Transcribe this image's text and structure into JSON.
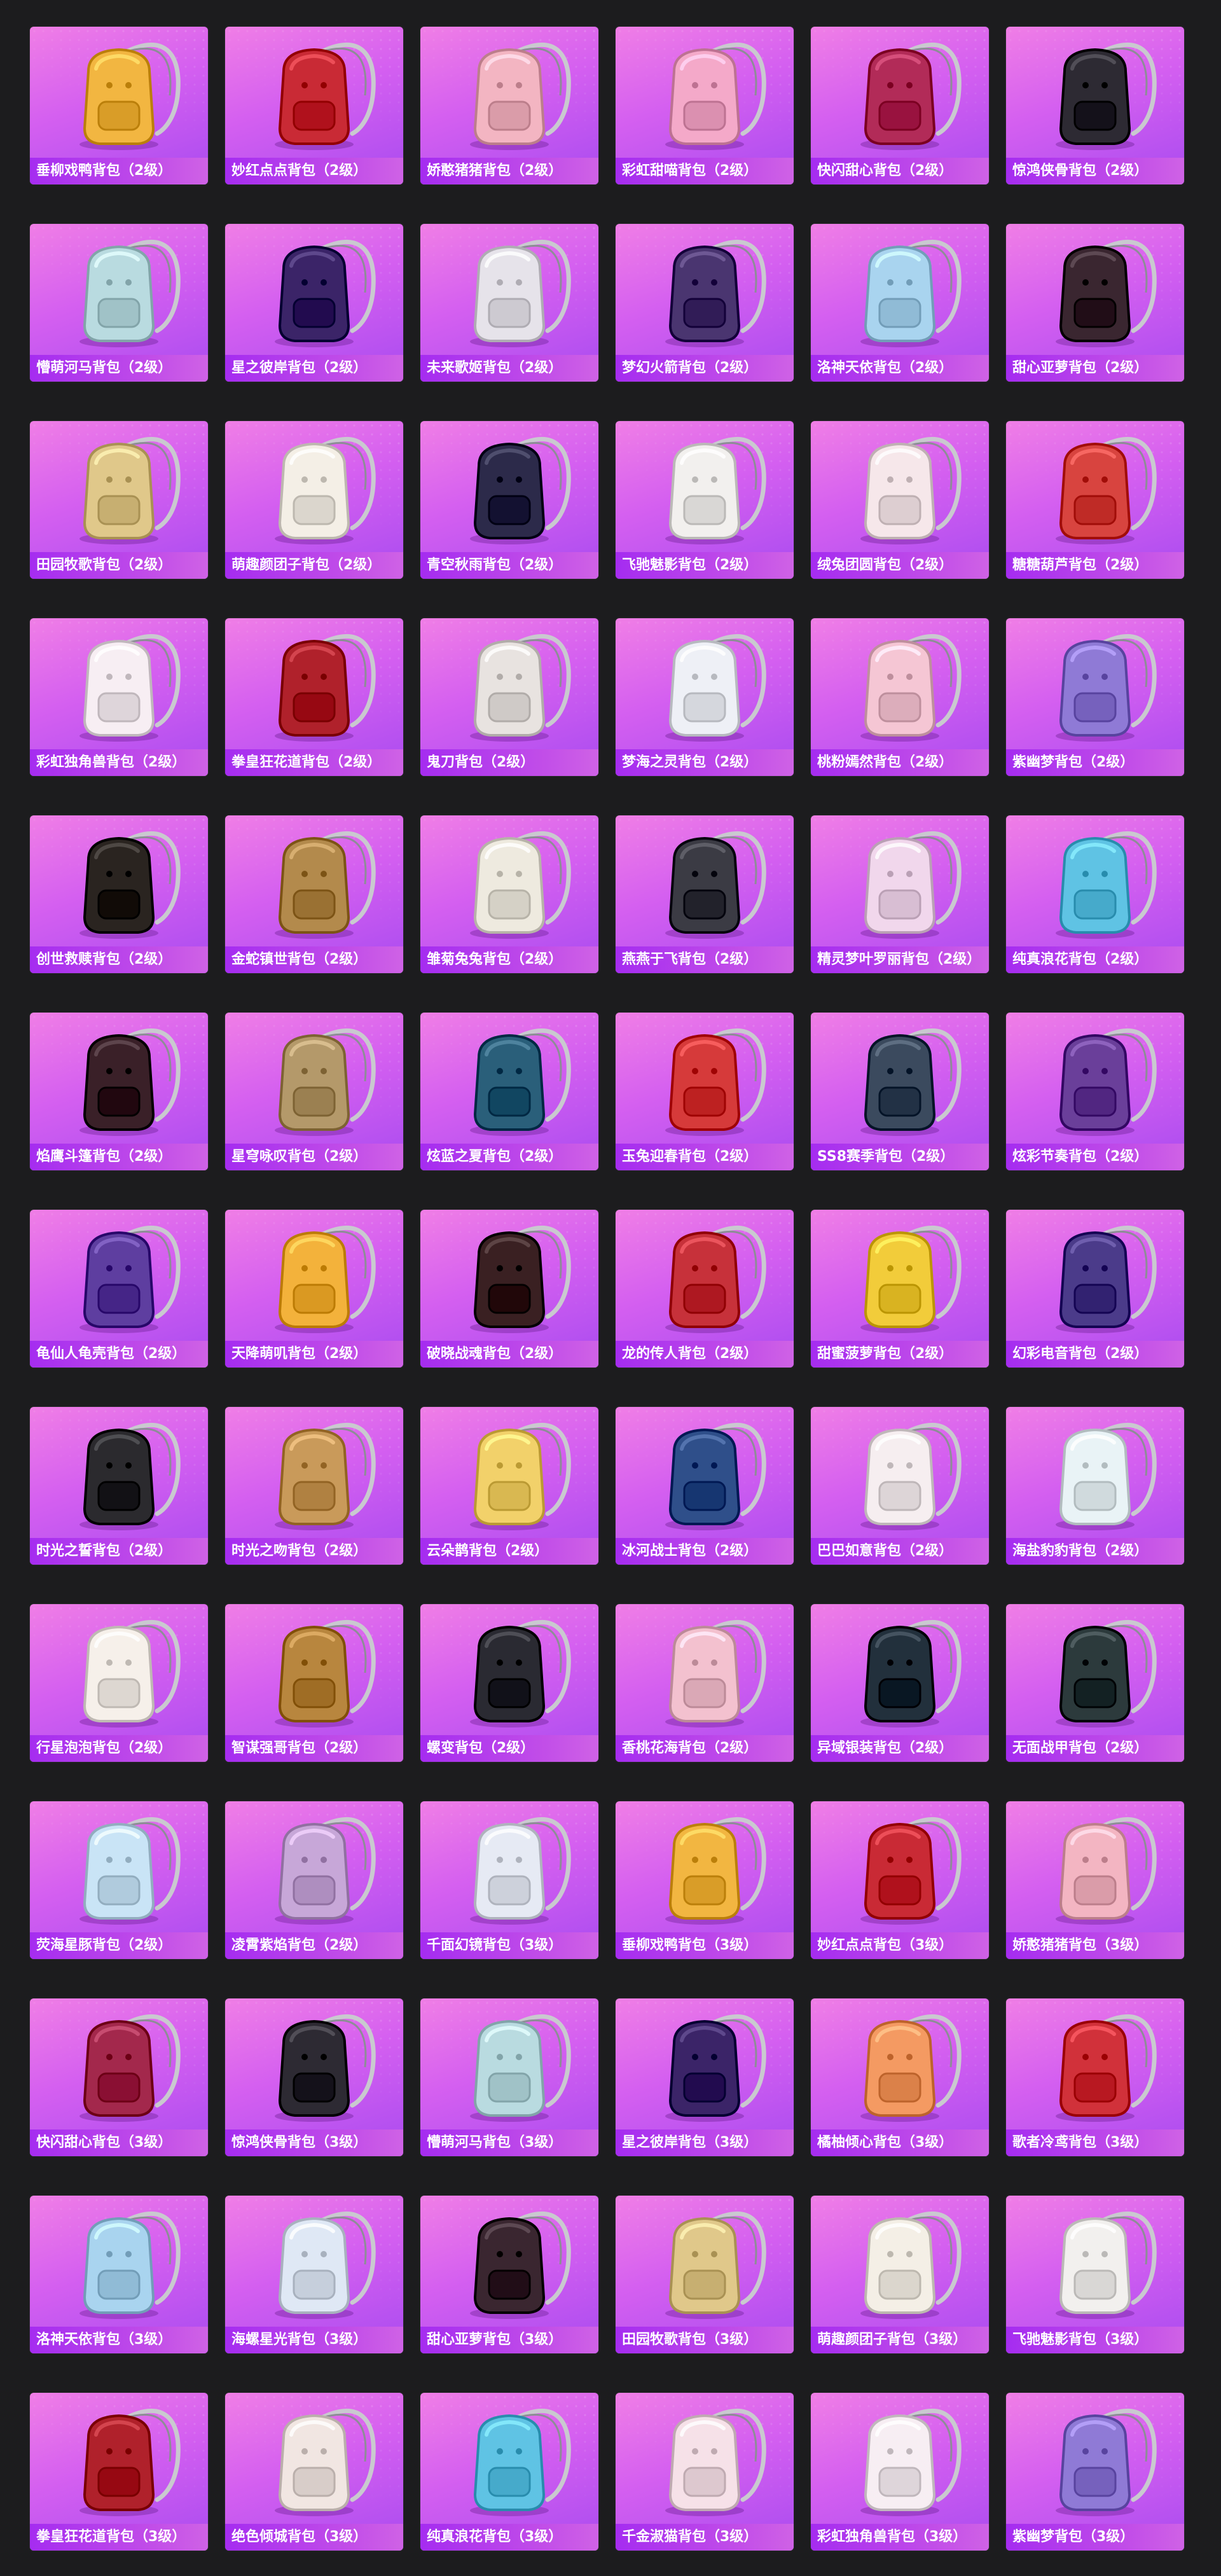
{
  "items": [
    {
      "name": "垂柳戏鸭背包（2级）",
      "color": "#f2b641",
      "icon": "backpack-icon"
    },
    {
      "name": "妙红点点背包（2级）",
      "color": "#c92a35",
      "icon": "backpack-icon"
    },
    {
      "name": "娇憨猪猪背包（2级）",
      "color": "#f3b5c2",
      "icon": "backpack-icon"
    },
    {
      "name": "彩虹甜喵背包（2级）",
      "color": "#f4a9c9",
      "icon": "backpack-icon"
    },
    {
      "name": "快闪甜心背包（2级）",
      "color": "#b22b58",
      "icon": "backpack-icon"
    },
    {
      "name": "惊鸿侠骨背包（2级）",
      "color": "#2d2a33",
      "icon": "backpack-icon"
    },
    {
      "name": "懵萌河马背包（2级）",
      "color": "#b9dbe0",
      "icon": "backpack-icon"
    },
    {
      "name": "星之彼岸背包（2级）",
      "color": "#3b2468",
      "icon": "backpack-icon"
    },
    {
      "name": "未来歌姬背包（2级）",
      "color": "#e6e3ea",
      "icon": "backpack-icon"
    },
    {
      "name": "梦幻火箭背包（2级）",
      "color": "#4a3570",
      "icon": "backpack-icon"
    },
    {
      "name": "洛神天依背包（2级）",
      "color": "#a9d4ef",
      "icon": "backpack-icon"
    },
    {
      "name": "甜心亚萝背包（2级）",
      "color": "#3a2630",
      "icon": "backpack-icon"
    },
    {
      "name": "田园牧歌背包（2级）",
      "color": "#e0c88a",
      "icon": "backpack-icon"
    },
    {
      "name": "萌趣颜团子背包（2级）",
      "color": "#f4efe6",
      "icon": "backpack-icon"
    },
    {
      "name": "青空秋雨背包（2级）",
      "color": "#2c2a4a",
      "icon": "backpack-icon"
    },
    {
      "name": "飞驰魅影背包（2级）",
      "color": "#f2f0ee",
      "icon": "backpack-icon"
    },
    {
      "name": "绒兔团圆背包（2级）",
      "color": "#f6e7ea",
      "icon": "backpack-icon"
    },
    {
      "name": "糖糖葫芦背包（2级）",
      "color": "#d8443f",
      "icon": "backpack-icon"
    },
    {
      "name": "彩虹独角兽背包（2级）",
      "color": "#f7eef3",
      "icon": "backpack-icon"
    },
    {
      "name": "拳皇狂花道背包（2级）",
      "color": "#b0212b",
      "icon": "backpack-icon"
    },
    {
      "name": "鬼刀背包（2级）",
      "color": "#e8e3e0",
      "icon": "backpack-icon"
    },
    {
      "name": "梦海之灵背包（2级）",
      "color": "#eef0f6",
      "icon": "backpack-icon"
    },
    {
      "name": "桃粉嫣然背包（2级）",
      "color": "#f5c6d4",
      "icon": "backpack-icon"
    },
    {
      "name": "紫幽梦背包（2级）",
      "color": "#8f7ad6",
      "icon": "backpack-icon"
    },
    {
      "name": "创世救赎背包（2级）",
      "color": "#2a2420",
      "icon": "backpack-icon"
    },
    {
      "name": "金蛇镇世背包（2级）",
      "color": "#b38a4c",
      "icon": "backpack-icon"
    },
    {
      "name": "雏菊兔兔背包（2级）",
      "color": "#eeeadf",
      "icon": "backpack-icon"
    },
    {
      "name": "燕燕于飞背包（2级）",
      "color": "#3b3b44",
      "icon": "backpack-icon"
    },
    {
      "name": "精灵梦叶罗丽背包（2级）",
      "color": "#f1d7ec",
      "icon": "backpack-icon"
    },
    {
      "name": "纯真浪花背包（2级）",
      "color": "#5fc3e4",
      "icon": "backpack-icon"
    },
    {
      "name": "焰鹰斗篷背包（2级）",
      "color": "#3a2028",
      "icon": "backpack-icon"
    },
    {
      "name": "星穹咏叹背包（2级）",
      "color": "#b4996a",
      "icon": "backpack-icon"
    },
    {
      "name": "炫蓝之夏背包（2级）",
      "color": "#2a5f7a",
      "icon": "backpack-icon"
    },
    {
      "name": "玉兔迎春背包（2级）",
      "color": "#d63a3a",
      "icon": "backpack-icon"
    },
    {
      "name": "SS8赛季背包（2级）",
      "color": "#3b4a5e",
      "icon": "backpack-icon"
    },
    {
      "name": "炫彩节奏背包（2级）",
      "color": "#6a3f9a",
      "icon": "backpack-icon"
    },
    {
      "name": "龟仙人龟壳背包（2级）",
      "color": "#5e3ea0",
      "icon": "backpack-icon"
    },
    {
      "name": "天降萌叽背包（2级）",
      "color": "#f3b23b",
      "icon": "backpack-icon"
    },
    {
      "name": "破晓战魂背包（2级）",
      "color": "#3a2022",
      "icon": "backpack-icon"
    },
    {
      "name": "龙的传人背包（2级）",
      "color": "#c7313a",
      "icon": "backpack-icon"
    },
    {
      "name": "甜蜜菠萝背包（2级）",
      "color": "#f2cc3a",
      "icon": "backpack-icon"
    },
    {
      "name": "幻彩电音背包（2级）",
      "color": "#4b3b8a",
      "icon": "backpack-icon"
    },
    {
      "name": "时光之誓背包（2级）",
      "color": "#2b2a2e",
      "icon": "backpack-icon"
    },
    {
      "name": "时光之吻背包（2级）",
      "color": "#c99a5a",
      "icon": "backpack-icon"
    },
    {
      "name": "云朵鹊背包（2级）",
      "color": "#f2d16a",
      "icon": "backpack-icon"
    },
    {
      "name": "冰河战士背包（2级）",
      "color": "#2f4f8a",
      "icon": "backpack-icon"
    },
    {
      "name": "巴巴如意背包（2级）",
      "color": "#f6eef0",
      "icon": "backpack-icon"
    },
    {
      "name": "海盐豹豹背包（2级）",
      "color": "#e9f3f6",
      "icon": "backpack-icon"
    },
    {
      "name": "行星泡泡背包（2级）",
      "color": "#f6f0ea",
      "icon": "backpack-icon"
    },
    {
      "name": "智谋强哥背包（2级）",
      "color": "#b8863e",
      "icon": "backpack-icon"
    },
    {
      "name": "螺变背包（2级）",
      "color": "#2a2a32",
      "icon": "backpack-icon"
    },
    {
      "name": "香桃花海背包（2级）",
      "color": "#f3c1cf",
      "icon": "backpack-icon"
    },
    {
      "name": "异域银装背包（2级）",
      "color": "#22303c",
      "icon": "backpack-icon"
    },
    {
      "name": "无面战甲背包（2级）",
      "color": "#2c3a3c",
      "icon": "backpack-icon"
    },
    {
      "name": "荧海星豚背包（2级）",
      "color": "#c9e4f6",
      "icon": "backpack-icon"
    },
    {
      "name": "凌霄紫焰背包（2级）",
      "color": "#c7a7d8",
      "icon": "backpack-icon"
    },
    {
      "name": "千面幻镜背包（3级）",
      "color": "#e6eaf4",
      "icon": "backpack-icon"
    },
    {
      "name": "垂柳戏鸭背包（3级）",
      "color": "#f2b641",
      "icon": "backpack-icon"
    },
    {
      "name": "妙红点点背包（3级）",
      "color": "#c92a35",
      "icon": "backpack-icon"
    },
    {
      "name": "娇憨猪猪背包（3级）",
      "color": "#f3b5c2",
      "icon": "backpack-icon"
    },
    {
      "name": "快闪甜心背包（3级）",
      "color": "#a3284c",
      "icon": "backpack-icon"
    },
    {
      "name": "惊鸿侠骨背包（3级）",
      "color": "#2d2a33",
      "icon": "backpack-icon"
    },
    {
      "name": "懵萌河马背包（3级）",
      "color": "#b9dbe0",
      "icon": "backpack-icon"
    },
    {
      "name": "星之彼岸背包（3级）",
      "color": "#3b2468",
      "icon": "backpack-icon"
    },
    {
      "name": "橘柚倾心背包（3级）",
      "color": "#f49a62",
      "icon": "backpack-icon"
    },
    {
      "name": "歌者冷鸢背包（3级）",
      "color": "#d1313a",
      "icon": "backpack-icon"
    },
    {
      "name": "洛神天依背包（3级）",
      "color": "#a9d4ef",
      "icon": "backpack-icon"
    },
    {
      "name": "海螺星光背包（3级）",
      "color": "#dfe8f5",
      "icon": "backpack-icon"
    },
    {
      "name": "甜心亚萝背包（3级）",
      "color": "#3a2630",
      "icon": "backpack-icon"
    },
    {
      "name": "田园牧歌背包（3级）",
      "color": "#e0c88a",
      "icon": "backpack-icon"
    },
    {
      "name": "萌趣颜团子背包（3级）",
      "color": "#f4efe6",
      "icon": "backpack-icon"
    },
    {
      "name": "飞驰魅影背包（3级）",
      "color": "#f2f0ee",
      "icon": "backpack-icon"
    },
    {
      "name": "拳皇狂花道背包（3级）",
      "color": "#b0212b",
      "icon": "backpack-icon"
    },
    {
      "name": "绝色倾城背包（3级）",
      "color": "#f1e6e2",
      "icon": "backpack-icon"
    },
    {
      "name": "纯真浪花背包（3级）",
      "color": "#5fc3e4",
      "icon": "backpack-icon"
    },
    {
      "name": "千金淑猫背包（3级）",
      "color": "#f6e1e8",
      "icon": "backpack-icon"
    },
    {
      "name": "彩虹独角兽背包（3级）",
      "color": "#f7eef3",
      "icon": "backpack-icon"
    },
    {
      "name": "紫幽梦背包（3级）",
      "color": "#8f7ad6",
      "icon": "backpack-icon"
    }
  ]
}
